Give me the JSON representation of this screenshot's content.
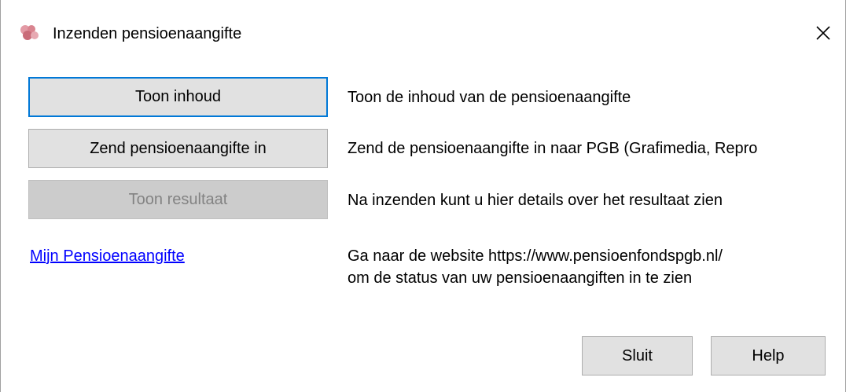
{
  "window": {
    "title": "Inzenden pensioenaangifte",
    "close_glyph": "✕"
  },
  "actions": [
    {
      "button_label": "Toon inhoud",
      "description": "Toon de inhoud van de pensioenaangifte",
      "state": "default"
    },
    {
      "button_label": "Zend pensioenaangifte in",
      "description": "Zend de pensioenaangifte in naar PGB (Grafimedia, Repro",
      "state": "normal"
    },
    {
      "button_label": "Toon resultaat",
      "description": "Na inzenden kunt u hier details over het resultaat zien",
      "state": "disabled"
    }
  ],
  "link": {
    "label": "Mijn Pensioenaangifte",
    "description_line1": "Ga naar de website https://www.pensioenfondspgb.nl/",
    "description_line2": "om de status van uw pensioenaangiften in te zien"
  },
  "footer": {
    "close_label": "Sluit",
    "help_label": "Help"
  },
  "colors": {
    "focus_border": "#0078d7",
    "link": "#0000ff",
    "button_face": "#e1e1e1",
    "icon": "#d9848f"
  },
  "icons": {
    "app": "pgb-logo-icon",
    "close": "close-icon"
  }
}
